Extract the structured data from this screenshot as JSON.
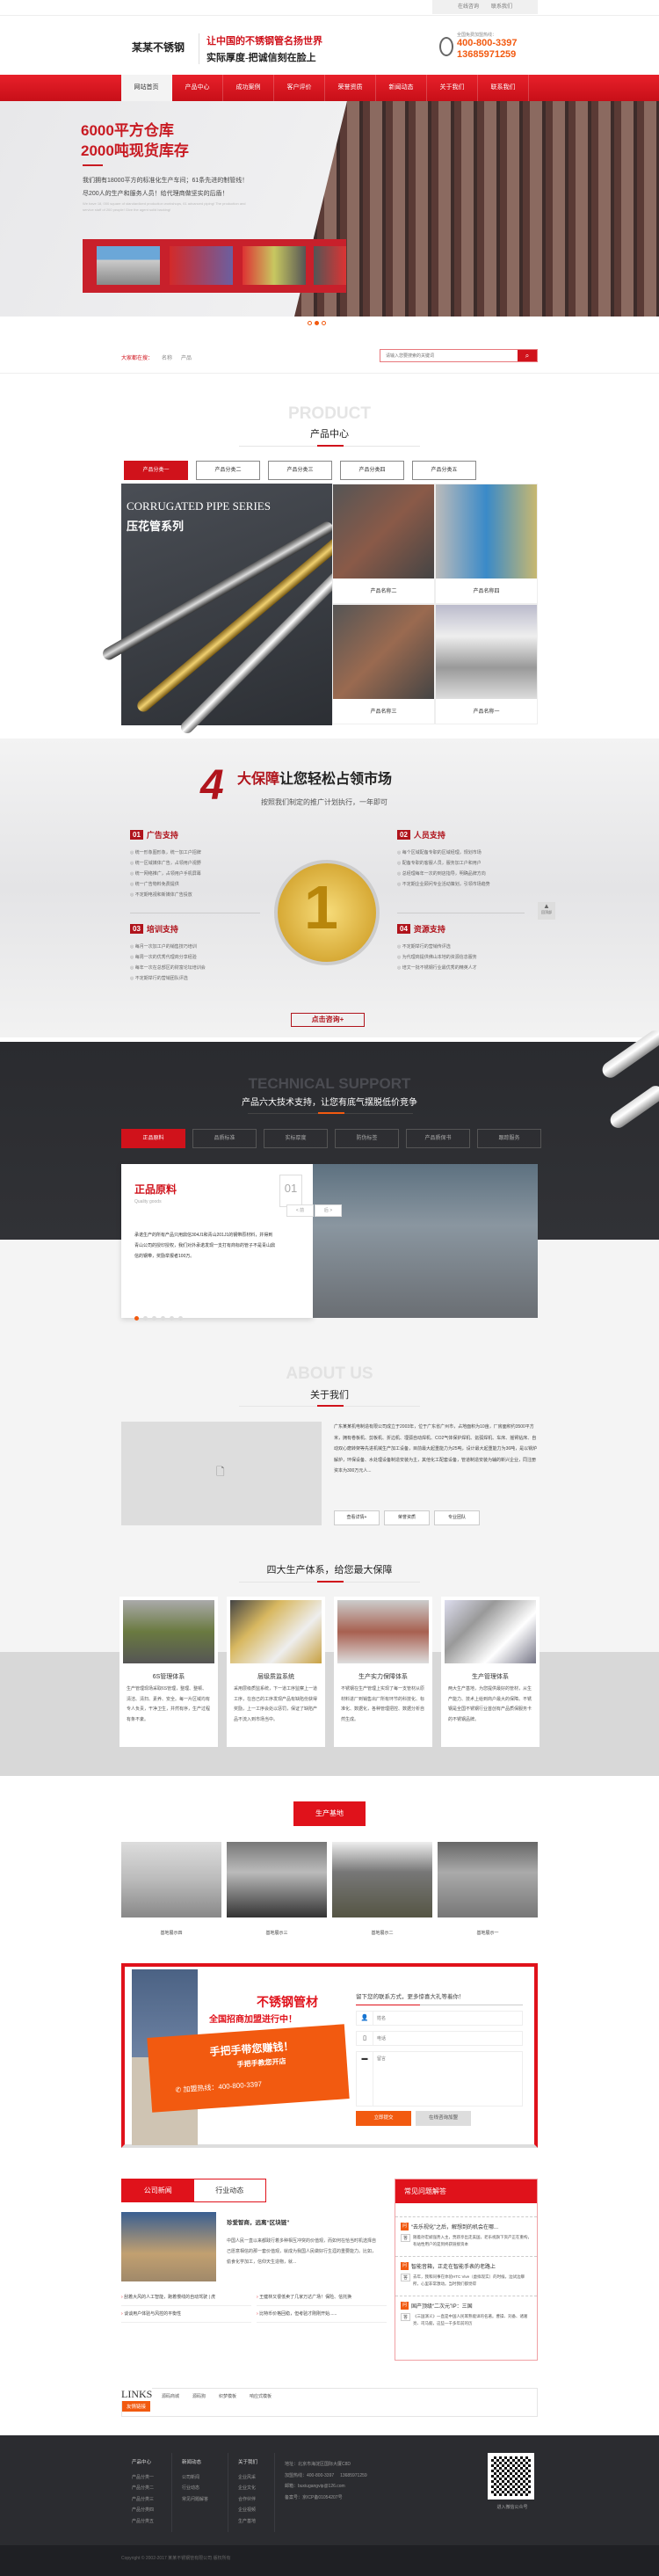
{
  "topbar": {
    "links": [
      "在线咨询",
      "联系我们"
    ]
  },
  "header": {
    "logo": "某某不锈钢",
    "slogan_1": "让中国的不锈钢管名扬世界",
    "slogan_2": "实际厚度-把诚信刻在脸上",
    "hotline_label": "全国免费加盟热线：",
    "phone_1": "400-800-3397",
    "phone_2": "13685971259"
  },
  "nav": [
    "网站首页",
    "产品中心",
    "成功案例",
    "客户评价",
    "荣誉资质",
    "新闻动态",
    "关于我们",
    "联系我们"
  ],
  "banner": {
    "title_1": "6000平方仓库",
    "title_2": "2000吨现货库存",
    "text": "我们拥有18000平方的标准化生产车间；61条先进的制管线！尽200人的生产和服务人员！给代理商做坚实的后盾！",
    "text_en": "We have 18, 000 square of standardized production workshops, 61 advanced piping! The production and service staff of 200 people! Give the agent solid backing!",
    "slides": 3,
    "active_slide": 2
  },
  "breadcrumb": {
    "label": "大家都在搜：",
    "items": [
      "名称",
      "产品"
    ]
  },
  "search": {
    "placeholder": "请输入您要搜索的关键词",
    "icon": "search-icon"
  },
  "products": {
    "en": "PRODUCT",
    "title": "产品中心",
    "tabs": [
      "产品分类一",
      "产品分类二",
      "产品分类三",
      "产品分类四",
      "产品分类五"
    ],
    "feature_en": "CORRUGATED PIPE SERIES",
    "feature_cn": "压花管系列",
    "items": [
      "产品名称二",
      "产品名称四",
      "产品名称三",
      "产品名称一"
    ]
  },
  "guarantee": {
    "big": "4",
    "title_red": "大保障",
    "title": "让您轻松占领市场",
    "subtitle": "按照我们制定的推广计划执行，一年即可",
    "blocks": [
      {
        "num": "01",
        "title": "广告支持",
        "items": [
          "统一形象图形象，统一加工户招牌",
          "统一区域媒体广告，占领用户视野",
          "统一网络推广，占领用户手机屏幕",
          "统一广告物料免费提供",
          "不定期电视和新媒体广告投放"
        ]
      },
      {
        "num": "02",
        "title": "人员支持",
        "items": [
          "每个区域配备专职的区域经理，规划市场",
          "配备专职的客服人员，服务加工户和用户",
          "总经理每年一次的到店指导，明确品牌方向",
          "不定期企业顾问专业活动策划，引领市场趋势"
        ]
      },
      {
        "num": "03",
        "title": "培训支持",
        "items": [
          "每月一次加工户的销售技巧培训",
          "每周一次的优秀代理商分享经验",
          "每年一次在总部区的财富论坛培训会",
          "不定期举行的营销团队评选"
        ]
      },
      {
        "num": "04",
        "title": "资源支持",
        "items": [
          "不定期举行的营销传评选",
          "为代理商提供佛山本地的资源信息服务",
          "培文一批不锈钢行业最优秀的精英人才"
        ]
      }
    ],
    "button": "点击咨询+",
    "back_to_top": "回顶部"
  },
  "tech": {
    "en": "TECHNICAL SUPPORT",
    "title": "产品六大技术支持，让您有底气摆脱低价竞争",
    "tabs": [
      "正品原料",
      "品质标准",
      "实标厚度",
      "防伪标签",
      "产品质保书",
      "跟踪服务"
    ],
    "card": {
      "title": "正品原料",
      "en": "Quality goods",
      "num": "01",
      "text": "承诺生产的所有产品只用鼎信304J1和青山201J1的钢带原材料，并得到青山公司的授印授权，我们对外承诺发现一支打有商标的管子不是青山鼎信的钢带，奖励举报者100万。",
      "slides": 6,
      "active": 1
    },
    "prev": "< 前",
    "next": "后 >"
  },
  "about": {
    "en": "ABOUT US",
    "title": "关于我们",
    "text": "广东某某机电制造有限公司成立于2003年，位于广东省广州市，占地面积为10亩，厂房面积约3500平方米，拥有卷板机、剪板机、折边机、埋弧自动焊机、CO2气体保护焊机、氩弧焊机、车床、摇臂钻床、自动双心磨转架等先进机械生产加工设备，目前最大起重能力为25吨，设计最大起重能力为36吨，是以锅炉解炉，环保设备、水处理设备制造安装为主，其他化工配套设备，管道制造安装为辅的新兴企业，同注册资本为300万元人...",
    "buttons": [
      "查看详情+",
      "荣誉资质",
      "专业团队"
    ]
  },
  "systems": {
    "title": "四大生产体系，给您最大保障",
    "items": [
      {
        "title": "6S管理体系",
        "text": "生产管理现场采取6S管理，整理、整顿、清洁、清扫、素养、安全。每一片区域均有专人负责，干净卫生，井然有序，生产过程有条不紊。"
      },
      {
        "title": "层级质监系统",
        "text": "采用层级质监系统，下一道工序监察上一道工序，在自己的工序发现产品有缺陷份获得奖励，上一工序会处以惩罚，保证了缺陷产品不流入到市场当中。"
      },
      {
        "title": "生产实力保障体系",
        "text": "不锈钢在生产管理上实现了每一支管材从原材料进厂到销售出厂所有环节的科技化、标准化、数据化，各种管理把控、数据分析自然生成。"
      },
      {
        "title": "生产管理体系",
        "text": "两大生产基地，为您提供最好的管材，从生产能力、技术上给到商户最大的保障。不锈钢是全国不锈钢行业首创有产品质保服务卡的不锈钢品牌。"
      }
    ]
  },
  "base": {
    "title": "生产基地",
    "items": [
      "基地展示四",
      "基地展示三",
      "基地展示二",
      "基地展示一"
    ]
  },
  "contact": {
    "h1": "不锈钢管材",
    "h2": "全国招商加盟进行中！",
    "ribbon_1": "手把手带您赚钱！",
    "ribbon_2": "手把手教您开店",
    "ribbon_hotline": "加盟热线：400-800-3397",
    "form_title": "留下您的联系方式，更多惊喜大礼等着你！",
    "name_placeholder": "姓名",
    "phone_placeholder": "电话",
    "message_placeholder": "留言",
    "submit": "立即提交",
    "consult": "在线咨询加盟"
  },
  "news": {
    "tabs": [
      "公司新闻",
      "行业动态"
    ],
    "featured_title": "珍爱智商，远离“区块链”",
    "featured_text": "中国人民一直以来都践行着多种相互冲突的价值观，而如何在恰当时机选择自己愿意相信的那一套价值观，就成为我国人民做好行生涯的重要能力。比如，偷食化学加工，信仰天生造物，就...",
    "list": [
      "刮着大风的人工智能，跑着慢线的自动驾驶 | 虎",
      "谈谈用户体验与风控的平衡性",
      "王健林又很低卖了几家万达广场！保险、信托换",
      "比特币价格回稳，但考验才刚刚开始......"
    ]
  },
  "faq": {
    "title": "常见问题解答",
    "items": [
      {
        "q": "“去乐视化”之后，解想到的机会在哪...",
        "a": "随着孙宏斌强势入主，贾跃亭出走美国，老乐视旗下资产正在重构，有站性用户的是到终获链接资本"
      },
      {
        "q": "智能音箱，正走在智能手表的老路上",
        "a": "去年，我和同事在体验HTC Vive（虚拟现实）的时候，边试边聊所，心里非常激动。当时我们都觉得"
      },
      {
        "q": "国产顶级“二次元”IP：三国",
        "a": "《三国演义》一直是中国人民耳熟能详的名著。曹操、刘备、诸葛亮、司马懿，这些一千多年前的历"
      }
    ]
  },
  "links": {
    "en": "LINKS",
    "cn": "友情链接",
    "items": [
      "源码商城",
      "源码狗",
      "织梦模板",
      "响应式模板"
    ]
  },
  "footer": {
    "cols": [
      {
        "title": "产品中心",
        "items": [
          "产品分类一",
          "产品分类二",
          "产品分类三",
          "产品分类四",
          "产品分类五"
        ]
      },
      {
        "title": "新闻动态",
        "items": [
          "公司新闻",
          "行业动态",
          "常见问题解答"
        ]
      },
      {
        "title": "关于我们",
        "items": [
          "企业风采",
          "企业文化",
          "合作伙伴",
          "企业视频",
          "生产基地"
        ]
      }
    ],
    "address": "地址：北京市海淀区国际大厦C8D",
    "hotline": "加盟热线：400-800-3397     13685971259",
    "email": "邮箱：buxiugangvip@126.com",
    "icp": "备案号：京ICP备01054207号",
    "qr_label": "进入微信公众号",
    "copyright": "Copyright © 2002-2017 某某不锈钢管有限公司 版权所有"
  },
  "colors": {
    "primary": "#e0121b",
    "accent": "#f25a10",
    "dark": "#2b2c30"
  }
}
